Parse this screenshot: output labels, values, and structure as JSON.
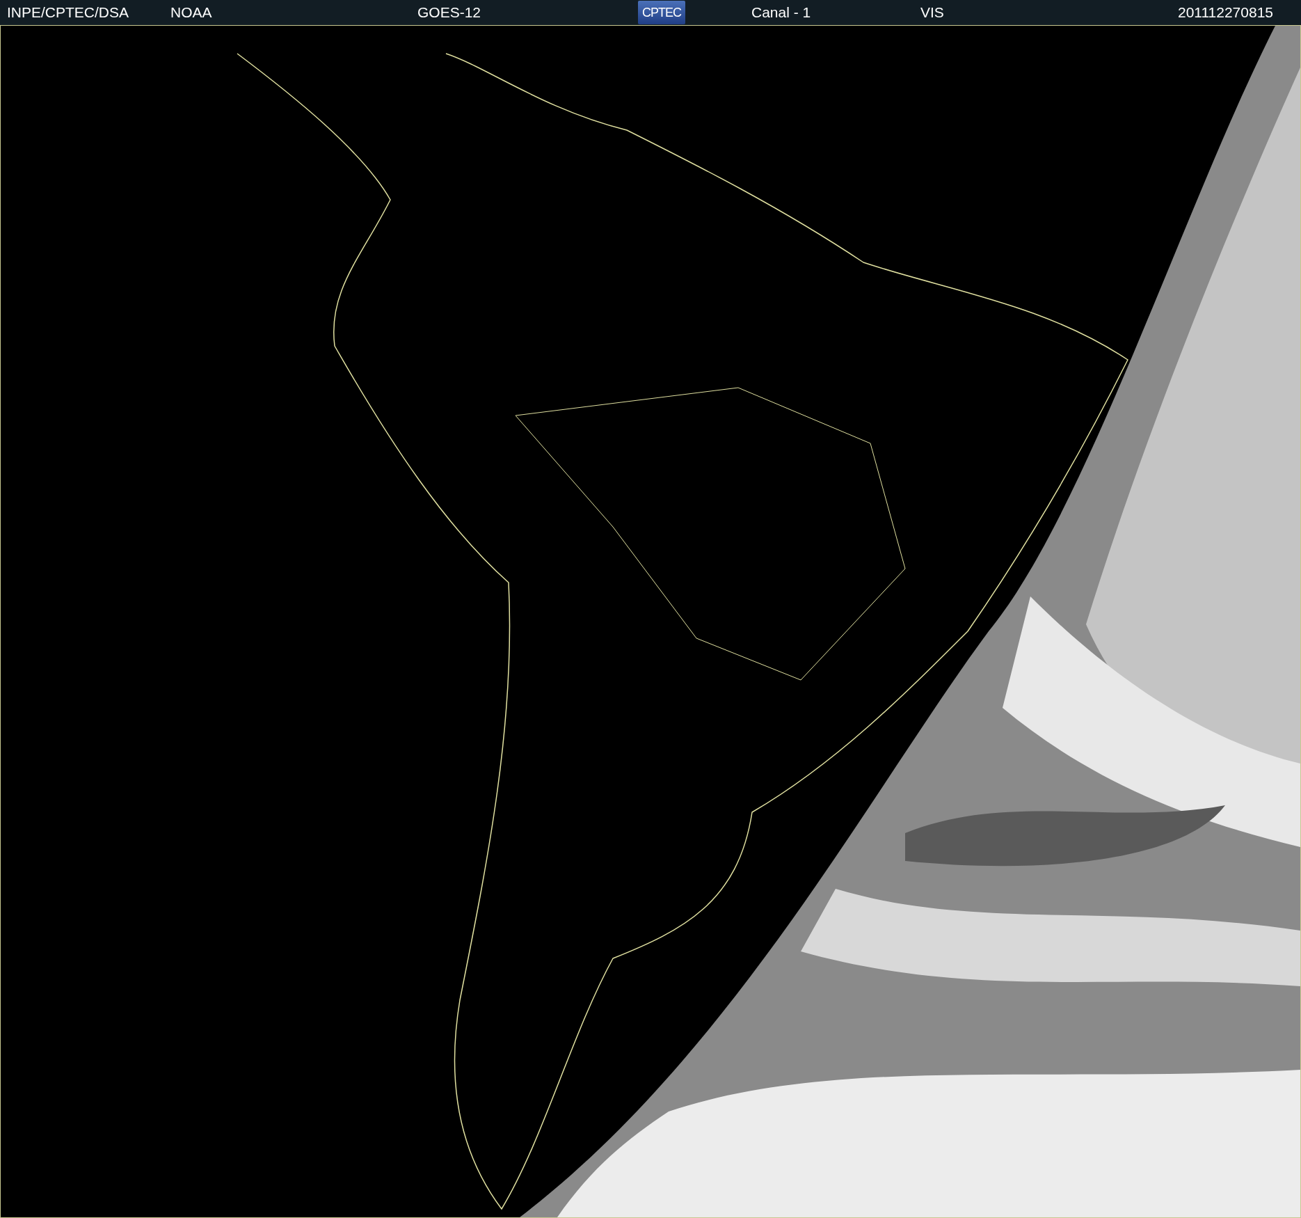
{
  "header": {
    "source": "INPE/CPTEC/DSA",
    "agency": "NOAA",
    "satellite": "GOES-12",
    "logo": "CPTEC",
    "channel": "Canal - 1",
    "band": "VIS",
    "timestamp": "201112270815"
  }
}
